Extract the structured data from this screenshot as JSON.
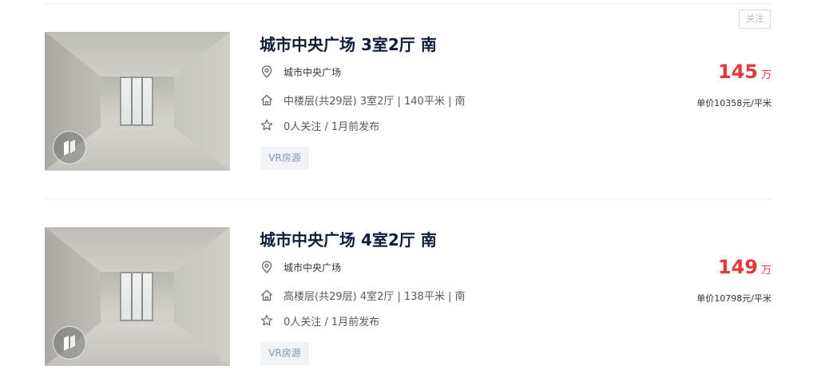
{
  "follow_label": "关注",
  "listings": [
    {
      "title": "城市中央广场 3室2厅 南",
      "location": "城市中央广场",
      "info": "中楼层(共29层) 3室2厅 | 140平米 | 南",
      "follow_info": "0人关注 / 1月前发布",
      "tag": "VR房源",
      "price_value": "145",
      "price_unit": "万",
      "unit_price": "单价10358元/平米"
    },
    {
      "title": "城市中央广场 4室2厅 南",
      "location": "城市中央广场",
      "info": "高楼层(共29层) 4室2厅 | 138平米 | 南",
      "follow_info": "0人关注 / 1月前发布",
      "tag": "VR房源",
      "price_value": "149",
      "price_unit": "万",
      "unit_price": "单价10798元/平米"
    }
  ],
  "colors": {
    "title": "#101d37",
    "price": "#e4393c",
    "tag_text": "#849aae",
    "tag_bg": "#f1f3f6"
  },
  "icons": {
    "location": "location-pin-icon",
    "house": "house-icon",
    "star": "star-icon",
    "vr": "vr-badge-icon"
  }
}
